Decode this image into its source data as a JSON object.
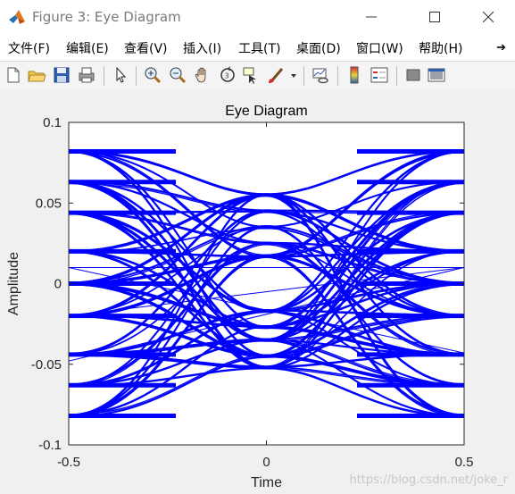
{
  "window": {
    "title": "Figure 3: Eye Diagram",
    "icon": "matlab-icon",
    "controls": [
      "minimize-icon",
      "maximize-icon",
      "close-icon"
    ]
  },
  "menu": {
    "items": [
      "文件(F)",
      "编辑(E)",
      "查看(V)",
      "插入(I)",
      "工具(T)",
      "桌面(D)",
      "窗口(W)",
      "帮助(H)"
    ],
    "overflow_icon": "chevron-right-icon"
  },
  "toolbar": {
    "icons": [
      "new-figure-icon",
      "open-icon",
      "save-icon",
      "print-icon",
      "pointer-icon",
      "zoom-in-icon",
      "zoom-out-icon",
      "pan-hand-icon",
      "rotate-3d-icon",
      "data-cursor-icon",
      "brush-icon",
      "dropdown-arrow-icon",
      "link-plot-icon",
      "colorbar-icon",
      "legend-icon",
      "hide-plot-tools-icon",
      "show-plot-tools-icon"
    ]
  },
  "chart_data": {
    "type": "line",
    "title": "Eye Diagram",
    "xlabel": "Time",
    "ylabel": "Amplitude",
    "xlim": [
      -0.5,
      0.5
    ],
    "ylim": [
      -0.1,
      0.1
    ],
    "xticks": [
      "-0.5",
      "0",
      "0.5"
    ],
    "yticks": [
      "0.1",
      "0.05",
      "0",
      "-0.05",
      "-0.1"
    ],
    "line_color": "#0000ff",
    "grid": false,
    "signal_levels": [
      0.082,
      0.063,
      0.044,
      0.02,
      0.0,
      -0.02,
      -0.044,
      -0.063,
      -0.082
    ],
    "center_levels": [
      0.055,
      0.045,
      0.035,
      0.025,
      0.017,
      -0.017,
      -0.027,
      -0.035,
      -0.045,
      -0.052
    ]
  },
  "watermark": "https://blog.csdn.net/joke_r"
}
